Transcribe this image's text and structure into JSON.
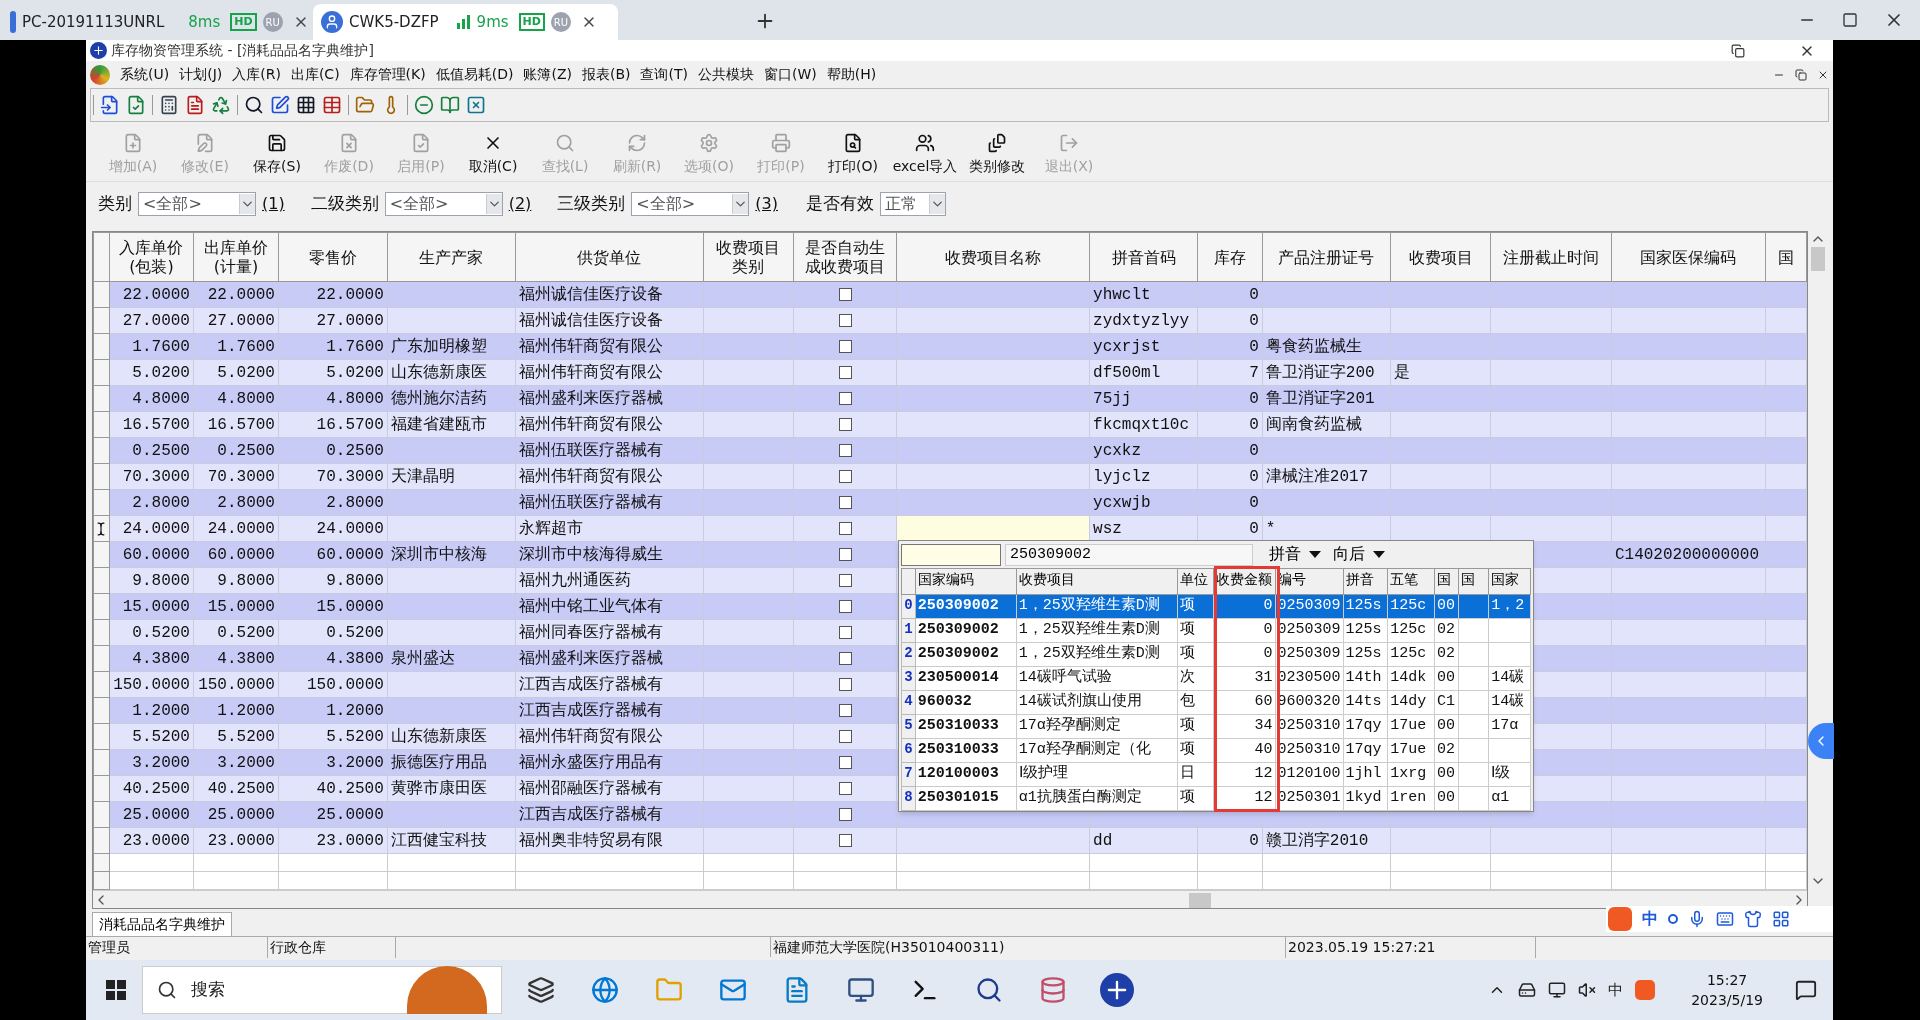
{
  "browser_tabs": [
    {
      "title": "PC-20191113UNRL",
      "ping": "8ms",
      "badge": "HD",
      "user": "RU",
      "selected": false
    },
    {
      "title": "CWK5-DZFP",
      "ping": "9ms",
      "badge": "HD",
      "user": "RU",
      "selected": true
    }
  ],
  "window": {
    "title": "库存物资管理系统 - [消耗品品名字典维护]"
  },
  "menu": [
    "系统(U)",
    "计划(J)",
    "入库(R)",
    "出库(C)",
    "库存管理(K)",
    "低值易耗(D)",
    "账簿(Z)",
    "报表(B)",
    "查询(T)",
    "公共模块",
    "窗口(W)",
    "帮助(H)"
  ],
  "toolbar_actions": [
    {
      "label": "增加(A)",
      "disabled": true
    },
    {
      "label": "修改(E)",
      "disabled": true
    },
    {
      "label": "保存(S)",
      "disabled": false
    },
    {
      "label": "作废(D)",
      "disabled": true
    },
    {
      "label": "启用(P)",
      "disabled": true
    },
    {
      "label": "取消(C)",
      "disabled": false
    },
    {
      "label": "查找(L)",
      "disabled": true
    },
    {
      "label": "刷新(R)",
      "disabled": true
    },
    {
      "label": "选项(O)",
      "disabled": true
    },
    {
      "label": "打印(P)",
      "disabled": true
    },
    {
      "label": "打印(O)",
      "disabled": false
    },
    {
      "label": "excel导入",
      "disabled": false
    },
    {
      "label": "类别修改",
      "disabled": false
    },
    {
      "label": "退出(X)",
      "disabled": true
    }
  ],
  "filters": [
    {
      "label": "类别",
      "value": "<全部>",
      "shortcut": "(1)"
    },
    {
      "label": "二级类别",
      "value": "<全部>",
      "shortcut": "(2)"
    },
    {
      "label": "三级类别",
      "value": "<全部>",
      "shortcut": "(3)"
    }
  ],
  "validity": {
    "label": "是否有效",
    "value": "正常"
  },
  "table": {
    "columns": [
      {
        "label": "入库单价(包装)",
        "kind": "number"
      },
      {
        "label": "出库单价(计量)",
        "kind": "number"
      },
      {
        "label": "零售价",
        "kind": "number"
      },
      {
        "label": "生产产家",
        "kind": "text"
      },
      {
        "label": "供货单位",
        "kind": "text"
      },
      {
        "label": "收费项目类别",
        "kind": "text"
      },
      {
        "label": "是否自动生成收费项目",
        "kind": "check"
      },
      {
        "label": "收费项目名称",
        "kind": "text"
      },
      {
        "label": "拼音首码",
        "kind": "text"
      },
      {
        "label": "库存",
        "kind": "number"
      },
      {
        "label": "产品注册证号",
        "kind": "text"
      },
      {
        "label": "收费项目",
        "kind": "text"
      },
      {
        "label": "注册截止时间",
        "kind": "text"
      },
      {
        "label": "国家医保编码",
        "kind": "text"
      },
      {
        "label": "国",
        "kind": "text"
      }
    ],
    "rows": [
      {
        "cells": [
          "22.0000",
          "22.0000",
          "22.0000",
          "",
          "福州诚信佳医疗设备",
          "",
          "",
          "",
          "yhwclt",
          "0",
          "",
          "",
          "",
          "",
          ""
        ],
        "checked": false,
        "current": false
      },
      {
        "cells": [
          "27.0000",
          "27.0000",
          "27.0000",
          "",
          "福州诚信佳医疗设备",
          "",
          "",
          "",
          "zydxtyzlyy",
          "0",
          "",
          "",
          "",
          "",
          ""
        ],
        "checked": false,
        "current": false
      },
      {
        "cells": [
          "1.7600",
          "1.7600",
          "1.7600",
          "广东加明橡塑",
          "福州伟轩商贸有限公",
          "",
          "",
          "",
          "ycxrjst",
          "0",
          "粤食药监械生",
          "",
          "",
          "",
          ""
        ],
        "checked": false,
        "current": false
      },
      {
        "cells": [
          "5.0200",
          "5.0200",
          "5.0200",
          "山东德新康医",
          "福州伟轩商贸有限公",
          "",
          "",
          "",
          "df500ml",
          "7",
          "鲁卫消证字200",
          "是",
          "",
          "",
          ""
        ],
        "checked": false,
        "current": false
      },
      {
        "cells": [
          "4.8000",
          "4.8000",
          "4.8000",
          "德州施尔洁药",
          "福州盛利来医疗器械",
          "",
          "",
          "",
          "75jj",
          "0",
          "鲁卫消证字201",
          "",
          "",
          "",
          ""
        ],
        "checked": false,
        "current": false
      },
      {
        "cells": [
          "16.5700",
          "16.5700",
          "16.5700",
          "福建省建瓯市",
          "福州伟轩商贸有限公",
          "",
          "",
          "",
          "fkcmqxt10c",
          "0",
          "闽南食药监械",
          "",
          "",
          "",
          ""
        ],
        "checked": false,
        "current": false
      },
      {
        "cells": [
          "0.2500",
          "0.2500",
          "0.2500",
          "",
          "福州伍联医疗器械有",
          "",
          "",
          "",
          "ycxkz",
          "0",
          "",
          "",
          "",
          "",
          ""
        ],
        "checked": false,
        "current": false
      },
      {
        "cells": [
          "70.3000",
          "70.3000",
          "70.3000",
          "天津晶明",
          "福州伟轩商贸有限公",
          "",
          "",
          "",
          "lyjclz",
          "0",
          "津械注准2017",
          "",
          "",
          "",
          ""
        ],
        "checked": false,
        "current": false
      },
      {
        "cells": [
          "2.8000",
          "2.8000",
          "2.8000",
          "",
          "福州伍联医疗器械有",
          "",
          "",
          "",
          "ycxwjb",
          "0",
          "",
          "",
          "",
          "",
          ""
        ],
        "checked": false,
        "current": false
      },
      {
        "cells": [
          "24.0000",
          "24.0000",
          "24.0000",
          "",
          "永辉超市",
          "",
          "",
          "",
          "wsz",
          "0",
          "*",
          "",
          "",
          "",
          ""
        ],
        "checked": false,
        "current": true
      },
      {
        "cells": [
          "60.0000",
          "60.0000",
          "60.0000",
          "深圳市中核海",
          "深圳市中核海得威生",
          "",
          "",
          "",
          "",
          "",
          "",
          "",
          "",
          "C14020200000000",
          ""
        ],
        "checked": false,
        "current": false
      },
      {
        "cells": [
          "9.8000",
          "9.8000",
          "9.8000",
          "",
          "福州九州通医药",
          "",
          "",
          "",
          "",
          "",
          "",
          "",
          "",
          "",
          ""
        ],
        "checked": false,
        "current": false
      },
      {
        "cells": [
          "15.0000",
          "15.0000",
          "15.0000",
          "",
          "福州中铭工业气体有",
          "",
          "",
          "",
          "",
          "",
          "",
          "",
          "",
          "",
          ""
        ],
        "checked": false,
        "current": false
      },
      {
        "cells": [
          "0.5200",
          "0.5200",
          "0.5200",
          "",
          "福州同春医疗器械有",
          "",
          "",
          "",
          "",
          "",
          "",
          "",
          "",
          "",
          ""
        ],
        "checked": false,
        "current": false
      },
      {
        "cells": [
          "4.3800",
          "4.3800",
          "4.3800",
          "泉州盛达",
          "福州盛利来医疗器械",
          "",
          "",
          "",
          "",
          "",
          "",
          "",
          "",
          "",
          ""
        ],
        "checked": false,
        "current": false
      },
      {
        "cells": [
          "150.0000",
          "150.0000",
          "150.0000",
          "",
          "江西吉成医疗器械有",
          "",
          "",
          "",
          "",
          "",
          "",
          "",
          "",
          "",
          ""
        ],
        "checked": false,
        "current": false
      },
      {
        "cells": [
          "1.2000",
          "1.2000",
          "1.2000",
          "",
          "江西吉成医疗器械有",
          "",
          "",
          "",
          "",
          "",
          "",
          "",
          "",
          "",
          ""
        ],
        "checked": false,
        "current": false
      },
      {
        "cells": [
          "5.5200",
          "5.5200",
          "5.5200",
          "山东德新康医",
          "福州伟轩商贸有限公",
          "",
          "",
          "",
          "",
          "",
          "",
          "",
          "",
          "",
          ""
        ],
        "checked": false,
        "current": false
      },
      {
        "cells": [
          "3.2000",
          "3.2000",
          "3.2000",
          "振德医疗用品",
          "福州永盛医疗用品有",
          "",
          "",
          "",
          "",
          "",
          "",
          "",
          "",
          "",
          ""
        ],
        "checked": false,
        "current": false
      },
      {
        "cells": [
          "40.2500",
          "40.2500",
          "40.2500",
          "黄骅市康田医",
          "福州邵融医疗器械有",
          "",
          "",
          "",
          "",
          "",
          "",
          "",
          "",
          "",
          ""
        ],
        "checked": false,
        "current": false
      },
      {
        "cells": [
          "25.0000",
          "25.0000",
          "25.0000",
          "",
          "江西吉成医疗器械有",
          "",
          "",
          "",
          "",
          "",
          "",
          "",
          "",
          "",
          ""
        ],
        "checked": false,
        "current": false
      },
      {
        "cells": [
          "23.0000",
          "23.0000",
          "23.0000",
          "江西健宝科技",
          "福州奥非特贸易有限",
          "",
          "",
          "",
          "dd",
          "0",
          "赣卫消字2010",
          "",
          "",
          "",
          ""
        ],
        "checked": false,
        "current": false
      }
    ]
  },
  "lookup_popup": {
    "code": "250309002",
    "dropdowns": [
      "拼音",
      "向后"
    ],
    "columns": [
      {
        "label": "国家编码",
        "kind": "code"
      },
      {
        "label": "收费项目",
        "kind": "text"
      },
      {
        "label": "单位",
        "kind": "text"
      },
      {
        "label": "收费金额",
        "kind": "number"
      },
      {
        "label": "编号",
        "kind": "text"
      },
      {
        "label": "拼音",
        "kind": "text"
      },
      {
        "label": "五笔",
        "kind": "text"
      },
      {
        "label": "国",
        "kind": "text"
      },
      {
        "label": "国",
        "kind": "text"
      },
      {
        "label": "国家",
        "kind": "text"
      }
    ],
    "rows": [
      {
        "index": "0",
        "cells": [
          "250309002",
          "1，25双羟维生素D测",
          "项",
          "0",
          "0250309",
          "125s",
          "125c",
          "00",
          "",
          "1，2"
        ],
        "selected": true
      },
      {
        "index": "1",
        "cells": [
          "250309002",
          "1，25双羟维生素D测",
          "项",
          "0",
          "0250309",
          "125s",
          "125c",
          "02",
          "",
          ""
        ],
        "selected": false
      },
      {
        "index": "2",
        "cells": [
          "250309002",
          "1，25双羟维生素D测",
          "项",
          "0",
          "0250309",
          "125s",
          "125c",
          "02",
          "",
          ""
        ],
        "selected": false
      },
      {
        "index": "3",
        "cells": [
          "230500014",
          "14碳呼气试验",
          "次",
          "31",
          "0230500",
          "14th",
          "14dk",
          "00",
          "",
          "14碳"
        ],
        "selected": false
      },
      {
        "index": "4",
        "cells": [
          "960032",
          "14碳试剂旗山使用",
          "包",
          "60",
          "9600320",
          "14ts",
          "14dy",
          "C1",
          "",
          "14碳"
        ],
        "selected": false
      },
      {
        "index": "5",
        "cells": [
          "250310033",
          "17α羟孕酮测定",
          "项",
          "34",
          "0250310",
          "17qy",
          "17ue",
          "00",
          "",
          "17α"
        ],
        "selected": false
      },
      {
        "index": "6",
        "cells": [
          "250310033",
          "17α羟孕酮测定（化",
          "项",
          "40",
          "0250310",
          "17qy",
          "17ue",
          "02",
          "",
          ""
        ],
        "selected": false
      },
      {
        "index": "7",
        "cells": [
          "120100003",
          "Ⅰ级护理",
          "日",
          "12",
          "0120100",
          "1jhl",
          "1xrg",
          "00",
          "",
          "Ⅰ级"
        ],
        "selected": false
      },
      {
        "index": "8",
        "cells": [
          "250301015",
          "α1抗胰蛋白酶测定",
          "项",
          "12",
          "0250301",
          "1kyd",
          "1ren",
          "00",
          "",
          "α1"
        ],
        "selected": false
      }
    ]
  },
  "document_tabs": [
    {
      "label": "消耗品品名字典维护",
      "selected": true
    }
  ],
  "status_bar": {
    "user": "管理员",
    "warehouse": "行政仓库",
    "hospital": "福建师范大学医院(H35010400311)",
    "datetime": "2023.05.19 15:27:21"
  },
  "ime_bar": {
    "mode": "中"
  },
  "taskbar": {
    "search": "搜索",
    "tray_ime": "中",
    "time": "15:27",
    "date": "2023/5/19"
  }
}
